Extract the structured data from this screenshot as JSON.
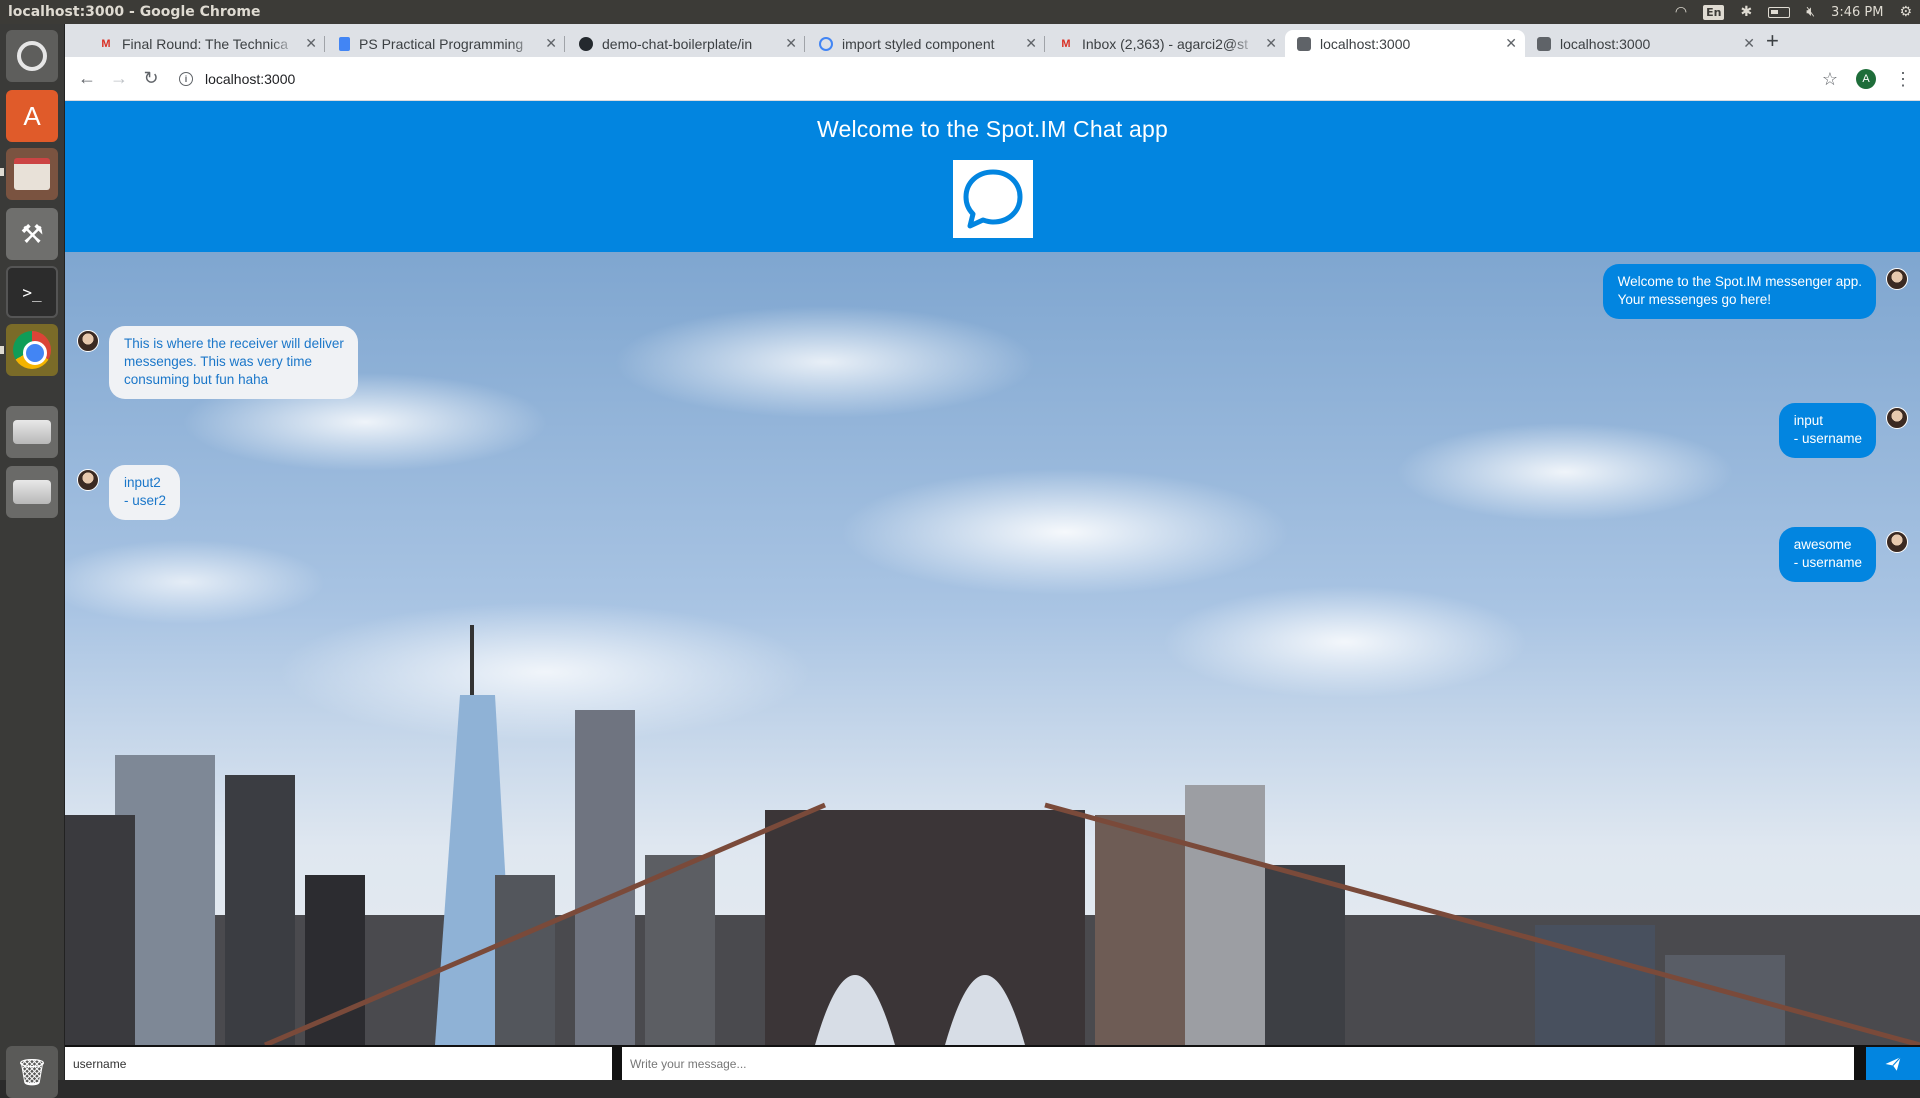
{
  "os": {
    "window_title": "localhost:3000 - Google Chrome",
    "keyboard_layout": "En",
    "clock": "3:46 PM"
  },
  "launcher": {
    "items": [
      "ubuntu-dash-icon",
      "software-center-icon",
      "files-icon",
      "system-settings-icon",
      "terminal-icon",
      "chrome-icon",
      "drive-icon",
      "drive-icon",
      "trash-icon"
    ]
  },
  "browser": {
    "tabs": [
      {
        "label": "Final Round: The Technica",
        "favicon": "gmail-icon"
      },
      {
        "label": "PS Practical Programming",
        "favicon": "docs-icon"
      },
      {
        "label": "demo-chat-boilerplate/in",
        "favicon": "github-icon"
      },
      {
        "label": "import styled component",
        "favicon": "google-icon"
      },
      {
        "label": "Inbox (2,363) - agarci2@st",
        "favicon": "gmail-icon"
      },
      {
        "label": "localhost:3000",
        "favicon": "app-icon",
        "active": true
      },
      {
        "label": "localhost:3000",
        "favicon": "app-icon"
      }
    ],
    "url": "localhost:3000",
    "profile_initial": "A"
  },
  "app": {
    "title": "Welcome to the Spot.IM Chat app",
    "accent_color": "#0285e0",
    "messages": [
      {
        "side": "right",
        "text": "Welcome to the Spot.IM messenger app.\nYour messenges go here!"
      },
      {
        "side": "left",
        "text": "This is where the receiver will deliver\nmessenges. This was very time\nconsuming but fun haha"
      },
      {
        "side": "right",
        "text": "input\n- username"
      },
      {
        "side": "left",
        "text": "input2\n- user2"
      },
      {
        "side": "right",
        "text": "awesome\n- username"
      }
    ],
    "compose": {
      "username_value": "username",
      "message_placeholder": "Write your message..."
    }
  }
}
